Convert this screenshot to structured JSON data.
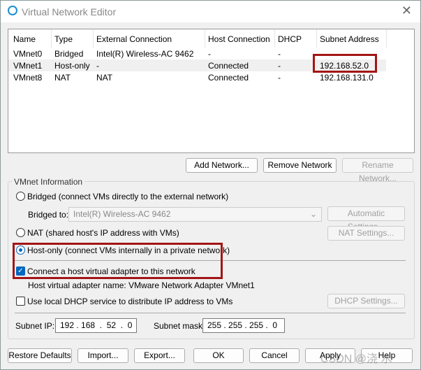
{
  "window": {
    "title": "Virtual Network Editor",
    "close": "✕"
  },
  "table": {
    "headers": [
      "Name",
      "Type",
      "External Connection",
      "Host Connection",
      "DHCP",
      "Subnet Address"
    ],
    "rows": [
      [
        "VMnet0",
        "Bridged",
        "Intel(R) Wireless-AC 9462",
        "-",
        "-",
        ""
      ],
      [
        "VMnet1",
        "Host-only",
        "-",
        "Connected",
        "-",
        "192.168.52.0"
      ],
      [
        "VMnet8",
        "NAT",
        "NAT",
        "Connected",
        "-",
        "192.168.131.0"
      ]
    ],
    "selected_row": 1
  },
  "actions": {
    "add": "Add Network...",
    "remove": "Remove Network",
    "rename": "Rename Network..."
  },
  "info": {
    "group_label": "VMnet Information",
    "bridged": "Bridged (connect VMs directly to the external network)",
    "bridged_to_label": "Bridged to:",
    "bridged_to_value": "Intel(R) Wireless-AC 9462",
    "auto_settings": "Automatic Settings...",
    "nat": "NAT (shared host's IP address with VMs)",
    "nat_settings": "NAT Settings...",
    "host_only": "Host-only (connect VMs internally in a private network)",
    "selected_mode": "host-only",
    "connect_adapter": "Connect a host virtual adapter to this network",
    "connect_adapter_checked": true,
    "adapter_name": "Host virtual adapter name: VMware Network Adapter VMnet1",
    "dhcp": "Use local DHCP service to distribute IP address to VMs",
    "dhcp_checked": false,
    "dhcp_settings": "DHCP Settings...",
    "subnet_ip_label": "Subnet IP:",
    "subnet_ip": "192 . 168  .  52  .  0",
    "subnet_mask_label": "Subnet mask:",
    "subnet_mask": "255 . 255 . 255 .  0"
  },
  "footer": {
    "restore": "Restore Defaults",
    "import": "Import...",
    "export": "Export...",
    "ok": "OK",
    "cancel": "Cancel",
    "apply": "Apply",
    "help": "Help"
  },
  "watermark": "CSDN @浇 水",
  "colors": {
    "accent": "#0067c0",
    "highlight_box": "#a31515"
  }
}
